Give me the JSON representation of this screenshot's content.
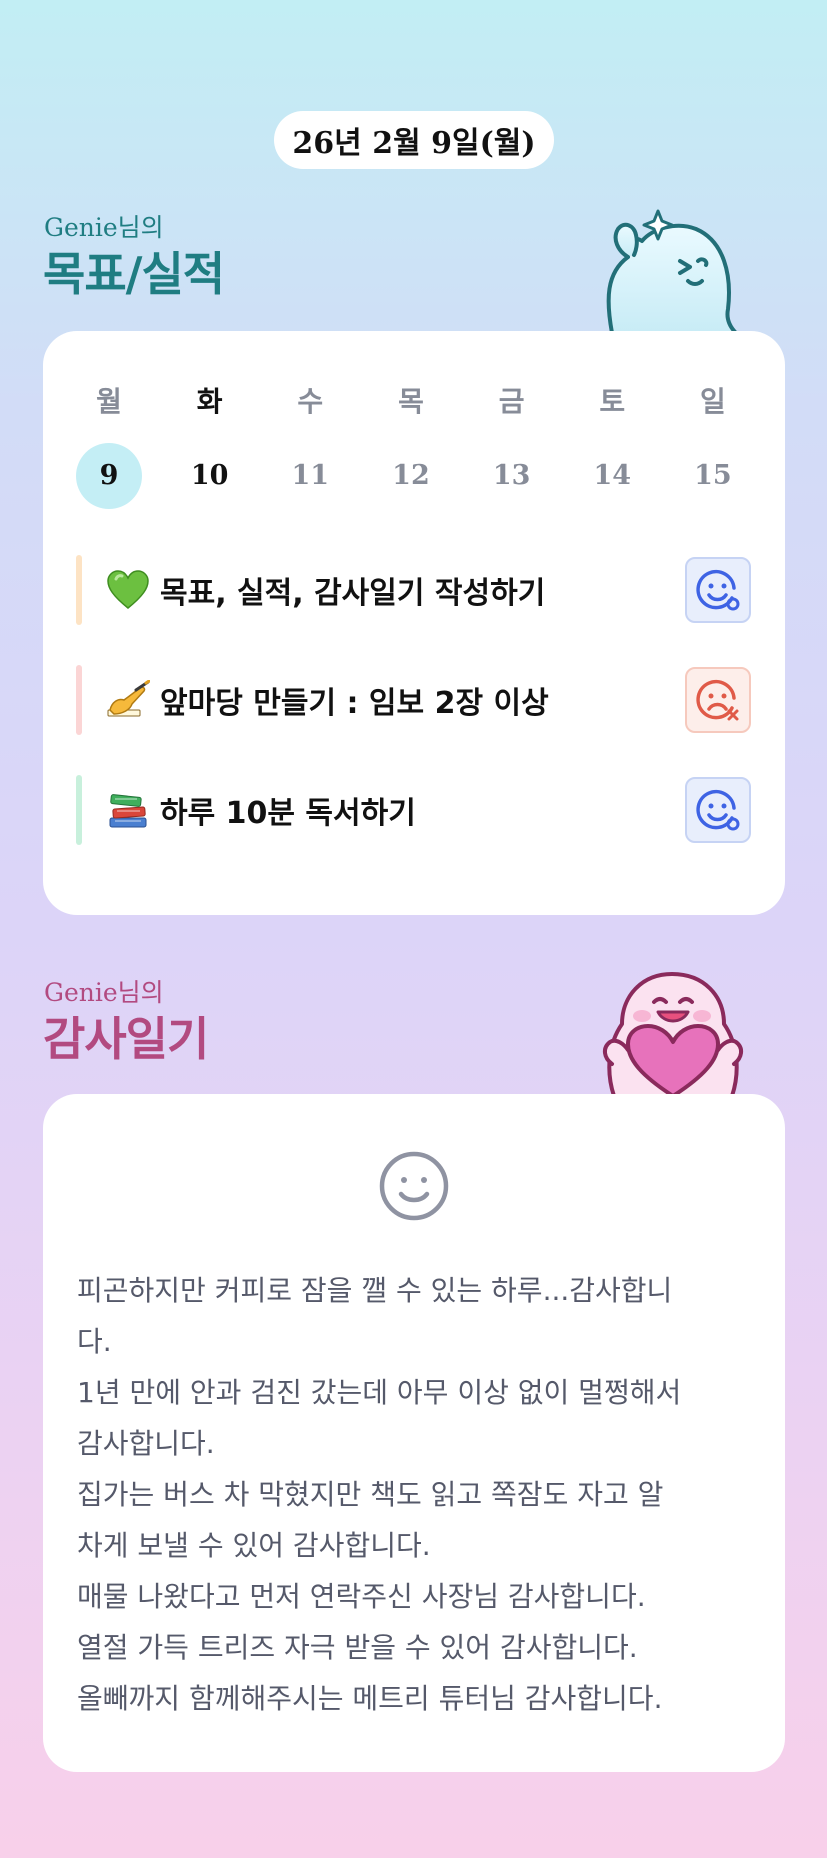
{
  "header": {
    "date": "26년 2월 9일(월)"
  },
  "goals_section": {
    "subtitle": "Genie님의",
    "title": "목표/실적",
    "weekdays": [
      "월",
      "화",
      "수",
      "목",
      "금",
      "토",
      "일"
    ],
    "days": [
      "9",
      "10",
      "11",
      "12",
      "13",
      "14",
      "15"
    ],
    "selected_index": 0,
    "highlighted_index": 1,
    "goals": [
      {
        "emoji": "green-heart-icon",
        "text": "목표, 실적, 감사일기 작성하기",
        "status": "smile-icon",
        "bar_color": "#fde3c4"
      },
      {
        "emoji": "writing-hand-icon",
        "text": "앞마당 만들기 : 임보 2장 이상",
        "status": "frown-icon",
        "bar_color": "#fbd5d5"
      },
      {
        "emoji": "books-icon",
        "text": "하루 10분 독서하기",
        "status": "smile-icon",
        "bar_color": "#c8f0dc"
      }
    ]
  },
  "gratitude_section": {
    "subtitle": "Genie님의",
    "title": "감사일기",
    "mood_icon": "smile-face-icon",
    "lines": [
      "피곤하지만 커피로 잠을 깰 수 있는 하루...감사합니",
      "다.",
      "1년 만에 안과 검진 갔는데 아무 이상 없이 멀쩡해서",
      "감사합니다.",
      "집가는 버스 차 막혔지만 책도 읽고 쪽잠도 자고 알",
      "차게 보낼 수 있어 감사합니다.",
      "매물 나왔다고 먼저 연락주신 사장님 감사합니다.",
      "열절 가득 트리즈 자극 받을 수 있어 감사합니다.",
      "올빼까지 함께해주시는 메트리 튜터님 감사합니다."
    ]
  },
  "colors": {
    "goals_accent": "#1f7d82",
    "gratitude_accent": "#b24a80",
    "today_circle": "#c4eef5",
    "good_status": "#3e63e4",
    "bad_status": "#e05a48"
  }
}
